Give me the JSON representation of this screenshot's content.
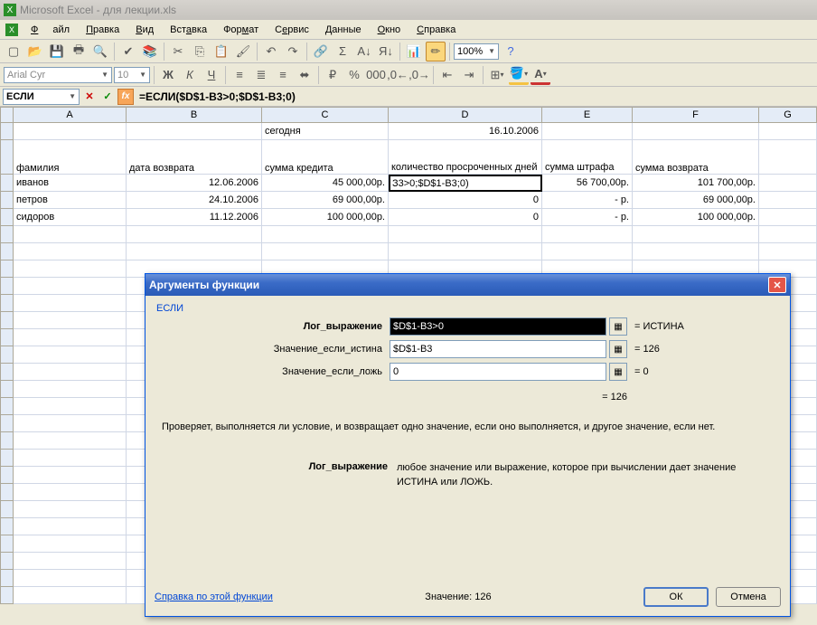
{
  "app": {
    "title": "Microsoft Excel - для лекции.xls"
  },
  "menu": {
    "file": "Файл",
    "edit": "Правка",
    "view": "Вид",
    "insert": "Вставка",
    "format": "Формат",
    "service": "Сервис",
    "data": "Данные",
    "window": "Окно",
    "help": "Справка"
  },
  "toolbar": {
    "font": "Arial Cyr",
    "size": "10",
    "zoom": "100%"
  },
  "formula": {
    "name": "ЕСЛИ",
    "text": "=ЕСЛИ($D$1-B3>0;$D$1-B3;0)"
  },
  "columns": [
    "A",
    "B",
    "C",
    "D",
    "E",
    "F",
    "G"
  ],
  "headers": {
    "c1": "сегодня",
    "d1": "16.10.2006",
    "a2": "фамилия",
    "b2": "дата возврата",
    "c2": "сумма кредита",
    "d2": "количество просроченных дней",
    "e2": "сумма штрафа",
    "f2": "сумма возврата"
  },
  "data": [
    {
      "a": "иванов",
      "b": "12.06.2006",
      "c": "45 000,00р.",
      "d": "З3>0;$D$1-B3;0)",
      "e": "56 700,00р.",
      "f": "101 700,00р."
    },
    {
      "a": "петров",
      "b": "24.10.2006",
      "c": "69 000,00р.",
      "d": "0",
      "e": "-   р.",
      "f": "69 000,00р."
    },
    {
      "a": "сидоров",
      "b": "11.12.2006",
      "c": "100 000,00р.",
      "d": "0",
      "e": "-   р.",
      "f": "100 000,00р."
    }
  ],
  "dialog": {
    "title": "Аргументы функции",
    "func": "ЕСЛИ",
    "args": {
      "log_label": "Лог_выражение",
      "log_val": "$D$1-B3>0",
      "log_res": "= ИСТИНА",
      "true_label": "Значение_если_истина",
      "true_val": "$D$1-B3",
      "true_res": "= 126",
      "false_label": "Значение_если_ложь",
      "false_val": "0",
      "false_res": "= 0"
    },
    "main_result": "= 126",
    "desc": "Проверяет, выполняется ли условие, и возвращает одно значение, если оно выполняется, и другое значение, если нет.",
    "argdesc_label": "Лог_выражение",
    "argdesc_text": "любое значение или выражение, которое при вычислении дает значение ИСТИНА или ЛОЖЬ.",
    "help": "Справка по этой функции",
    "value_label": "Значение:",
    "value": "126",
    "ok": "ОК",
    "cancel": "Отмена"
  }
}
